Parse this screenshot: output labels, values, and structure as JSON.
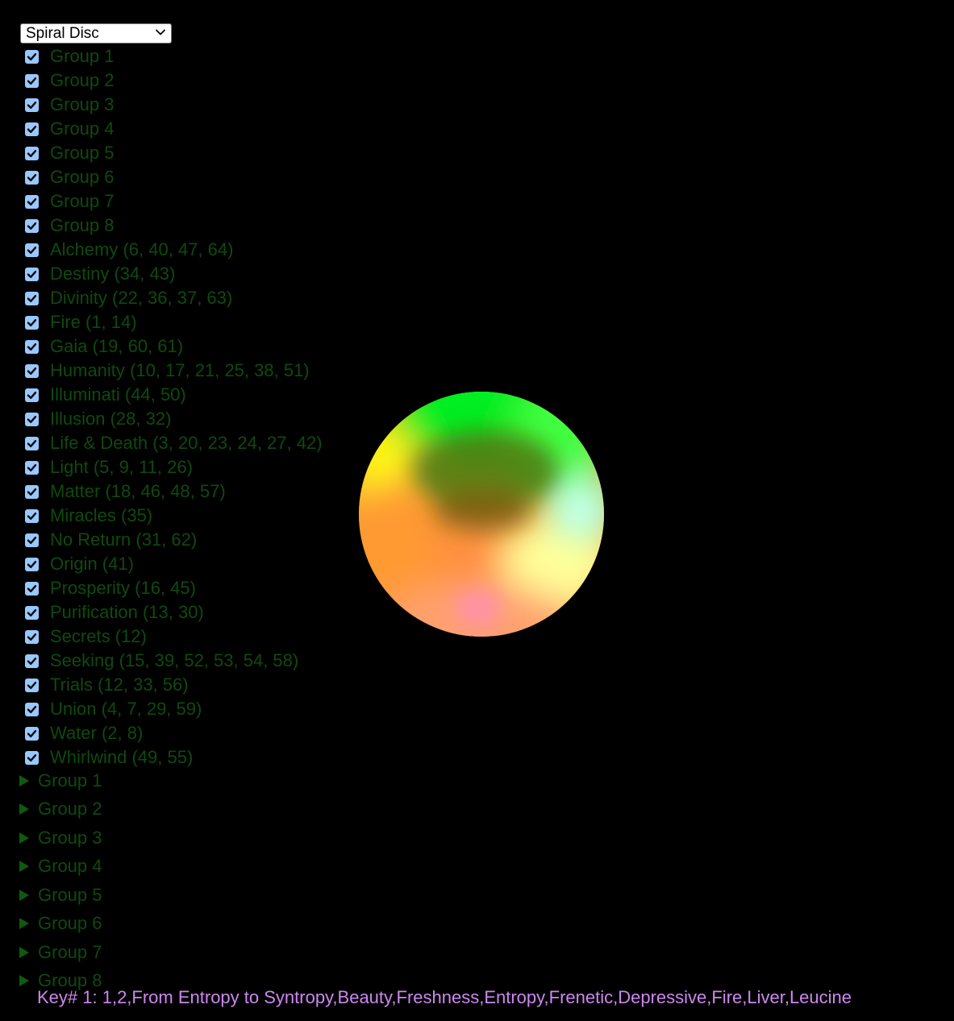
{
  "dropdown": {
    "selected": "Spiral Disc"
  },
  "checkboxes": [
    {
      "label": "Group 1",
      "checked": true
    },
    {
      "label": "Group 2",
      "checked": true
    },
    {
      "label": "Group 3",
      "checked": true
    },
    {
      "label": "Group 4",
      "checked": true
    },
    {
      "label": "Group 5",
      "checked": true
    },
    {
      "label": "Group 6",
      "checked": true
    },
    {
      "label": "Group 7",
      "checked": true
    },
    {
      "label": "Group 8",
      "checked": true
    },
    {
      "label": "Alchemy (6, 40, 47, 64)",
      "checked": true
    },
    {
      "label": "Destiny (34, 43)",
      "checked": true
    },
    {
      "label": "Divinity (22, 36, 37, 63)",
      "checked": true
    },
    {
      "label": "Fire (1, 14)",
      "checked": true
    },
    {
      "label": "Gaia (19, 60, 61)",
      "checked": true
    },
    {
      "label": "Humanity (10, 17, 21, 25, 38, 51)",
      "checked": true
    },
    {
      "label": "Illuminati (44, 50)",
      "checked": true
    },
    {
      "label": "Illusion (28, 32)",
      "checked": true
    },
    {
      "label": "Life & Death (3, 20, 23, 24, 27, 42)",
      "checked": true
    },
    {
      "label": "Light (5, 9, 11, 26)",
      "checked": true
    },
    {
      "label": "Matter (18, 46, 48, 57)",
      "checked": true
    },
    {
      "label": "Miracles (35)",
      "checked": true
    },
    {
      "label": "No Return (31, 62)",
      "checked": true
    },
    {
      "label": "Origin (41)",
      "checked": true
    },
    {
      "label": "Prosperity (16, 45)",
      "checked": true
    },
    {
      "label": "Purification (13, 30)",
      "checked": true
    },
    {
      "label": "Secrets (12)",
      "checked": true
    },
    {
      "label": "Seeking (15, 39, 52, 53, 54, 58)",
      "checked": true
    },
    {
      "label": "Trials (12, 33, 56)",
      "checked": true
    },
    {
      "label": "Union (4, 7, 29, 59)",
      "checked": true
    },
    {
      "label": "Water (2, 8)",
      "checked": true
    },
    {
      "label": "Whirlwind (49, 55)",
      "checked": true
    }
  ],
  "disclosures": [
    {
      "label": "Group 1"
    },
    {
      "label": "Group 2"
    },
    {
      "label": "Group 3"
    },
    {
      "label": "Group 4"
    },
    {
      "label": "Group 5"
    },
    {
      "label": "Group 6"
    },
    {
      "label": "Group 7"
    },
    {
      "label": "Group 8"
    }
  ],
  "key_line": "Key# 1: 1,2,From Entropy to Syntropy,Beauty,Freshness,Entropy,Frenetic,Depressive,Fire,Liver,Leucine",
  "colors": {
    "background": "#000000",
    "label_text": "#0f4a0f",
    "checkbox_fill": "#99c8ff",
    "key_text": "#cc88ee"
  }
}
